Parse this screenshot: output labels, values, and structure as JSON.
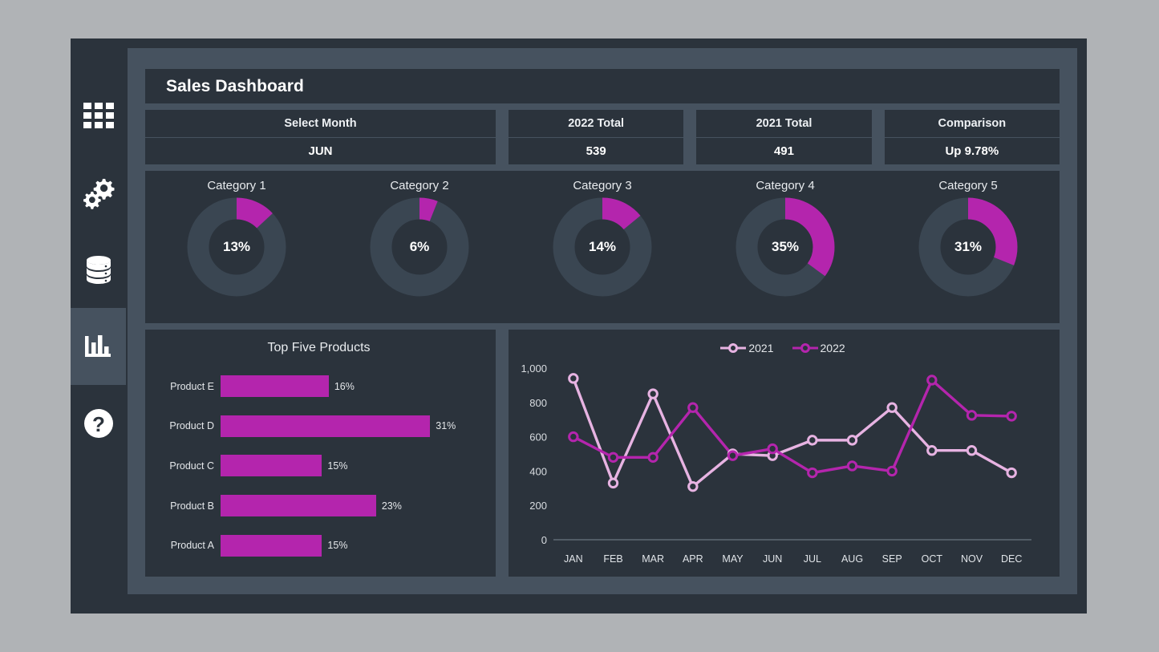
{
  "sidebar": {
    "items": [
      {
        "name": "apps-grid",
        "icon": "grid-icon",
        "active": false
      },
      {
        "name": "settings",
        "icon": "gears-icon",
        "active": false
      },
      {
        "name": "database",
        "icon": "database-icon",
        "active": false
      },
      {
        "name": "analytics",
        "icon": "bar-chart-icon",
        "active": true
      },
      {
        "name": "help",
        "icon": "question-mark-icon",
        "active": false
      }
    ]
  },
  "header": {
    "title": "Sales Dashboard"
  },
  "kpis": [
    {
      "label": "Select Month",
      "value": "JUN"
    },
    {
      "label": "2022 Total",
      "value": "539"
    },
    {
      "label": "2021 Total",
      "value": "491"
    },
    {
      "label": "Comparison",
      "value": "Up  9.78%"
    }
  ],
  "gauges": [
    {
      "title": "Category 1",
      "value": "13%",
      "pct": 13
    },
    {
      "title": "Category 2",
      "value": "6%",
      "pct": 6
    },
    {
      "title": "Category 3",
      "value": "14%",
      "pct": 14
    },
    {
      "title": "Category 4",
      "value": "35%",
      "pct": 35
    },
    {
      "title": "Category 5",
      "value": "31%",
      "pct": 31
    }
  ],
  "colors": {
    "accent": "#b425ad",
    "accent_light": "#e7b3e2",
    "panel": "#2b333c",
    "surface": "#46525f",
    "text": "#e9ecef",
    "page_bg": "#b0b3b6"
  },
  "chart_data": [
    {
      "type": "bar",
      "orientation": "horizontal",
      "title": "Top Five Products",
      "categories": [
        "Product E",
        "Product D",
        "Product C",
        "Product B",
        "Product A"
      ],
      "values": [
        16,
        31,
        15,
        23,
        15
      ],
      "value_labels": [
        "16%",
        "31%",
        "15%",
        "23%",
        "15%"
      ],
      "xlabel": "",
      "ylabel": "",
      "xlim": [
        0,
        35
      ],
      "grid": false,
      "series_color": "#b425ad"
    },
    {
      "type": "line",
      "title": "",
      "x": [
        "JAN",
        "FEB",
        "MAR",
        "APR",
        "MAY",
        "JUN",
        "JUL",
        "AUG",
        "SEP",
        "OCT",
        "NOV",
        "DEC"
      ],
      "series": [
        {
          "name": "2021",
          "color": "#e7b3e2",
          "values": [
            940,
            330,
            850,
            310,
            500,
            490,
            580,
            580,
            770,
            520,
            520,
            390
          ]
        },
        {
          "name": "2022",
          "color": "#b425ad",
          "values": [
            600,
            480,
            480,
            770,
            490,
            530,
            390,
            430,
            400,
            930,
            725,
            720
          ]
        }
      ],
      "ylim": [
        0,
        1000
      ],
      "yticks": [
        0,
        200,
        400,
        600,
        800,
        1000
      ],
      "ytick_labels": [
        "0",
        "200",
        "400",
        "600",
        "800",
        "1,000"
      ],
      "xlabel": "",
      "ylabel": "",
      "grid": false,
      "legend_position": "top-center",
      "marker": "open-circle"
    }
  ]
}
